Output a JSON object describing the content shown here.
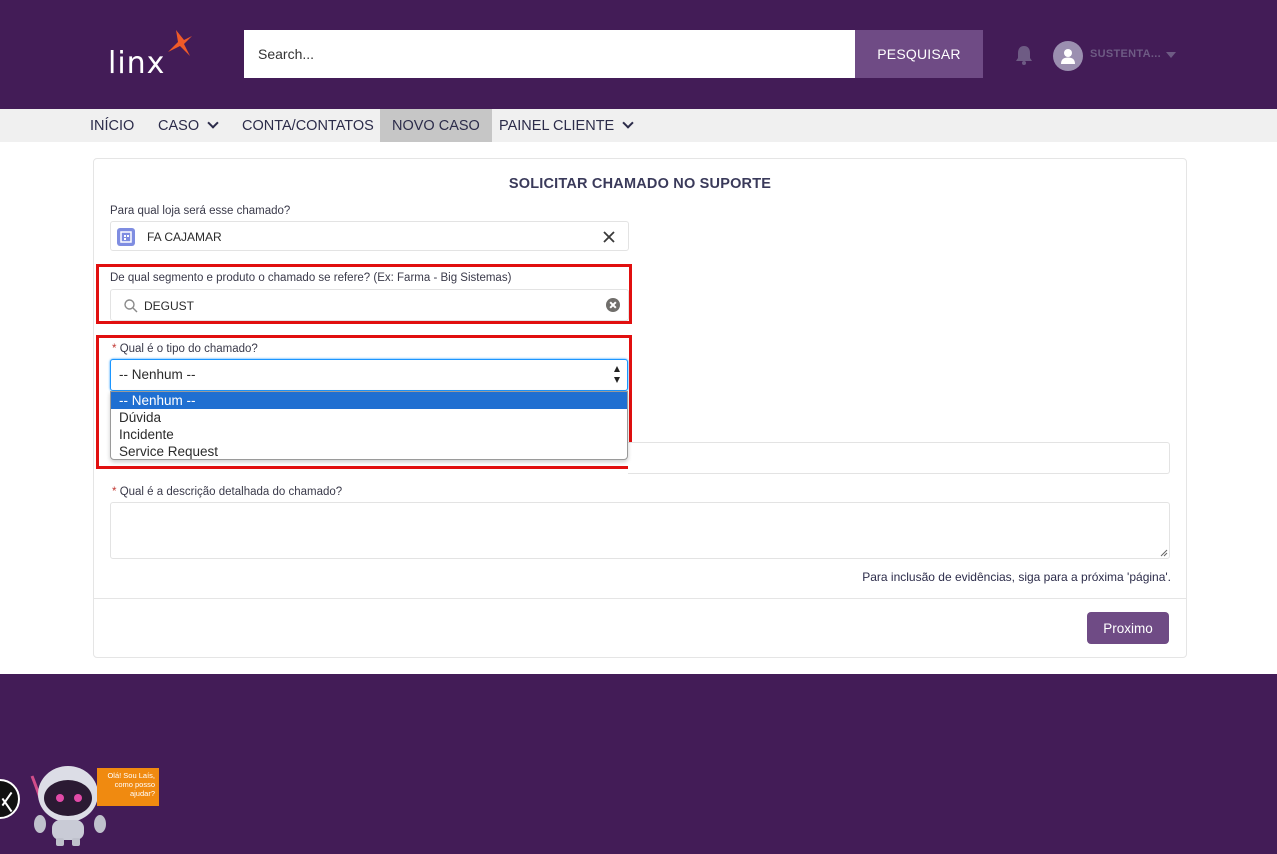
{
  "header": {
    "logo_text": "linx",
    "search_placeholder": "Search...",
    "search_button": "PESQUISAR",
    "user_name": "SUSTENTA..."
  },
  "nav": {
    "items": [
      {
        "label": "INÍCIO",
        "has_dropdown": false
      },
      {
        "label": "CASO",
        "has_dropdown": true
      },
      {
        "label": "CONTA/CONTATOS",
        "has_dropdown": false
      },
      {
        "label": "NOVO CASO",
        "has_dropdown": false,
        "active": true
      },
      {
        "label": "PAINEL CLIENTE",
        "has_dropdown": true
      }
    ]
  },
  "form": {
    "title": "SOLICITAR CHAMADO NO SUPORTE",
    "loja": {
      "label": "Para qual loja será esse chamado?",
      "value": "FA CAJAMAR"
    },
    "segmento": {
      "label": "De qual segmento e produto o chamado se refere? (Ex: Farma - Big Sistemas)",
      "value": "DEGUST"
    },
    "tipo": {
      "required_mark": "*",
      "label": "Qual é o tipo do chamado?",
      "value": "-- Nenhum --",
      "options": [
        "-- Nenhum --",
        "Dúvida",
        "Incidente",
        "Service Request"
      ]
    },
    "descricao": {
      "required_mark": "*",
      "label": "Qual é a descrição detalhada do chamado?"
    },
    "help_text": "Para inclusão de evidências, siga para a próxima 'página'.",
    "next_button": "Proximo"
  },
  "chatbot": {
    "bubble_line1": "Olá! Sou Laís,",
    "bubble_line2": "como posso",
    "bubble_line3": "ajudar?"
  },
  "colors": {
    "brand_purple": "#431c57",
    "button_purple": "#6f4b85",
    "highlight_red": "#e10f0f",
    "selected_blue": "#1f6fd1",
    "logo_orange": "#f05a28"
  }
}
